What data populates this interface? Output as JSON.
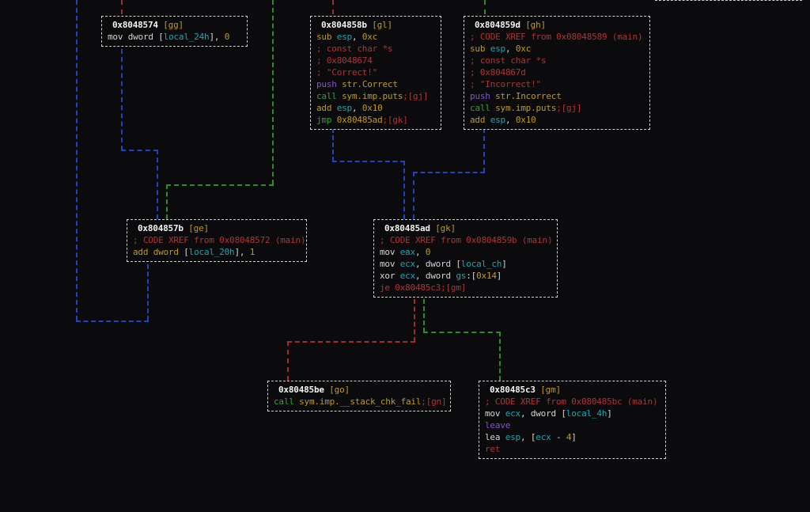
{
  "palette": {
    "background": "#0b0b0d",
    "box_border": "#cfcfcf",
    "address_white": "#f4f4f4",
    "text_white": "#d4d4d4",
    "yellow": "#c19b17",
    "cyan": "#1ba6b4",
    "red": "#b03434",
    "green": "#33a133",
    "magenta": "#8a4fd0",
    "edge_blue": "#2244bb",
    "edge_green": "#2a8f2a",
    "edge_red": "#a02e2e"
  },
  "graph": {
    "nodes": [
      {
        "id": "gg",
        "title": "0x8048574",
        "tag": "[gg]",
        "lines": [
          [
            [
              "mov dword [",
              "w"
            ],
            [
              "local_24h",
              "c"
            ],
            [
              "], ",
              "w"
            ],
            [
              "0",
              "y"
            ]
          ]
        ]
      },
      {
        "id": "gl",
        "title": "0x804858b",
        "tag": "[gl]",
        "lines": [
          [
            [
              "sub ",
              "y"
            ],
            [
              "esp",
              "c"
            ],
            [
              ", ",
              "w"
            ],
            [
              "0xc",
              "y"
            ]
          ],
          [
            [
              "; const char *s",
              "r"
            ]
          ],
          [
            [
              "; 0x8048674",
              "r"
            ]
          ],
          [
            [
              "; \"Correct!\"",
              "r"
            ]
          ],
          [
            [
              "push ",
              "m"
            ],
            [
              "str.Correct",
              "y"
            ]
          ],
          [
            [
              "call ",
              "g"
            ],
            [
              "sym.imp.puts",
              "y"
            ],
            [
              ";[gj]",
              "r"
            ]
          ],
          [
            [
              "add ",
              "y"
            ],
            [
              "esp",
              "c"
            ],
            [
              ", ",
              "w"
            ],
            [
              "0x10",
              "y"
            ]
          ],
          [
            [
              "jmp ",
              "g"
            ],
            [
              "0x80485ad",
              "y"
            ],
            [
              ";[gk]",
              "r"
            ]
          ]
        ]
      },
      {
        "id": "gh",
        "title": "0x804859d",
        "tag": "[gh]",
        "lines": [
          [
            [
              "; CODE XREF from 0x08048589 (main)",
              "r"
            ]
          ],
          [
            [
              "sub ",
              "y"
            ],
            [
              "esp",
              "c"
            ],
            [
              ", ",
              "w"
            ],
            [
              "0xc",
              "y"
            ]
          ],
          [
            [
              "; const char *s",
              "r"
            ]
          ],
          [
            [
              "; 0x804867d",
              "r"
            ]
          ],
          [
            [
              "; \"Incorrect!\"",
              "r"
            ]
          ],
          [
            [
              "push ",
              "m"
            ],
            [
              "str.Incorrect",
              "y"
            ]
          ],
          [
            [
              "call ",
              "g"
            ],
            [
              "sym.imp.puts",
              "y"
            ],
            [
              ";[gj]",
              "r"
            ]
          ],
          [
            [
              "add ",
              "y"
            ],
            [
              "esp",
              "c"
            ],
            [
              ", ",
              "w"
            ],
            [
              "0x10",
              "y"
            ]
          ]
        ]
      },
      {
        "id": "ge",
        "title": "0x804857b",
        "tag": "[ge]",
        "lines": [
          [
            [
              "; CODE XREF from 0x08048572 (main)",
              "r"
            ]
          ],
          [
            [
              "add dword ",
              "y"
            ],
            [
              "[",
              "w"
            ],
            [
              "local_20h",
              "c"
            ],
            [
              "], ",
              "w"
            ],
            [
              "1",
              "y"
            ]
          ]
        ]
      },
      {
        "id": "gk",
        "title": "0x80485ad",
        "tag": "[gk]",
        "lines": [
          [
            [
              "; CODE XREF from 0x0804859b (main)",
              "r"
            ]
          ],
          [
            [
              "mov ",
              "w"
            ],
            [
              "eax",
              "c"
            ],
            [
              ", ",
              "w"
            ],
            [
              "0",
              "y"
            ]
          ],
          [
            [
              "mov ",
              "w"
            ],
            [
              "ecx",
              "c"
            ],
            [
              ", dword [",
              "w"
            ],
            [
              "local_ch",
              "c"
            ],
            [
              "]",
              "w"
            ]
          ],
          [
            [
              "xor ",
              "w"
            ],
            [
              "ecx",
              "c"
            ],
            [
              ", dword ",
              "w"
            ],
            [
              "gs",
              "c"
            ],
            [
              ":[",
              "w"
            ],
            [
              "0x14",
              "y"
            ],
            [
              "]",
              "w"
            ]
          ],
          [
            [
              "je 0x80485c3;[gm]",
              "r"
            ]
          ]
        ]
      },
      {
        "id": "go",
        "title": "0x80485be",
        "tag": "[go]",
        "lines": [
          [
            [
              "call ",
              "g"
            ],
            [
              "sym.imp.__stack_chk_fail",
              "y"
            ],
            [
              ";[gn]",
              "r"
            ]
          ]
        ]
      },
      {
        "id": "gm",
        "title": "0x80485c3",
        "tag": "[gm]",
        "lines": [
          [
            [
              "; CODE XREF from 0x080485bc (main)",
              "r"
            ]
          ],
          [
            [
              "mov ",
              "w"
            ],
            [
              "ecx",
              "c"
            ],
            [
              ", dword [",
              "w"
            ],
            [
              "local_4h",
              "c"
            ],
            [
              "]",
              "w"
            ]
          ],
          [
            [
              "leave",
              "m"
            ]
          ],
          [
            [
              "lea ",
              "w"
            ],
            [
              "esp",
              "c"
            ],
            [
              ", [",
              "w"
            ],
            [
              "ecx",
              "c"
            ],
            [
              " - ",
              "w"
            ],
            [
              "4",
              "y"
            ],
            [
              "]",
              "w"
            ]
          ],
          [
            [
              "ret",
              "r"
            ]
          ]
        ]
      }
    ],
    "edges": [
      {
        "from": "offscreen-top",
        "to": "gg",
        "color": "red"
      },
      {
        "from": "offscreen-top",
        "to": "gl",
        "color": "red"
      },
      {
        "from": "offscreen-top",
        "to": "gh",
        "color": "green"
      },
      {
        "from": "offscreen-top",
        "to": "ge",
        "color": "green"
      },
      {
        "from": "ge",
        "to": "offscreen-top",
        "color": "blue"
      },
      {
        "from": "gg",
        "to": "ge",
        "color": "blue"
      },
      {
        "from": "gl",
        "to": "gk",
        "color": "blue"
      },
      {
        "from": "gh",
        "to": "gk",
        "color": "blue"
      },
      {
        "from": "gk",
        "to": "go",
        "color": "red"
      },
      {
        "from": "gk",
        "to": "gm",
        "color": "green"
      }
    ]
  }
}
